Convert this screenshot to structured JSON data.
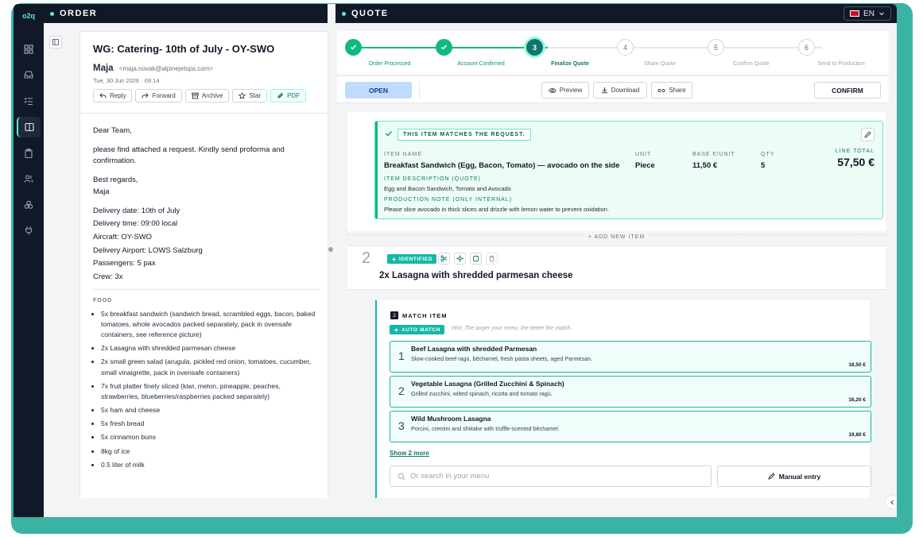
{
  "app": {
    "logo": "o2q"
  },
  "order_panel": {
    "title": "ORDER"
  },
  "quote_panel": {
    "title": "QUOTE",
    "language": "EN"
  },
  "email": {
    "subject": "WG: Catering- 10th of July - OY-SWO",
    "sender_name": "Maja",
    "sender_email": "<maja.novak@alpinejetops.com>",
    "date": "Tue, 30 Jun 2026 · 09:14",
    "actions": [
      "Reply",
      "Forward",
      "Archive",
      "Star",
      "PDF"
    ],
    "greeting": "Dear Team,",
    "intro": "please find attached a request. Kindly send proforma and confirmation.",
    "closing_1": "Best regards,",
    "closing_2": "Maja",
    "delivery": [
      "Delivery date: 10th of July",
      "Delivery time: 09:00 local",
      "Aircraft: OY-SWO",
      "Delivery Airport: LOWS Salzburg",
      "Passengers: 5 pax",
      "Crew: 3x"
    ],
    "food_label": "FOOD",
    "food": [
      "5x breakfast sandwich (sandwich bread, scrambled eggs, bacon, baked tomatoes, whole avocados packed separately, pack in ovensafe containers, see reference picture)",
      "2x Lasagna with shredded parmesan cheese",
      "2x small green salad (arugula, pickled red onion, tomatoes, cucumber, small vinaigrette, pack in ovensafe containers)",
      "7x fruit platter finely sliced (kiwi, melon, pineapple, peaches, strawberries, blueberries/raspberries packed separately)",
      "5x ham and cheese",
      "5x fresh bread",
      "5x cinnamon buns",
      "8kg of ice",
      "0.5 liter of milk"
    ]
  },
  "steps": [
    {
      "num": "✓",
      "label": "Order Processed",
      "state": "done"
    },
    {
      "num": "✓",
      "label": "Account Confirmed",
      "state": "done"
    },
    {
      "num": "3",
      "label": "Finalize Quote",
      "state": "current"
    },
    {
      "num": "4",
      "label": "Share Quote",
      "state": "todo"
    },
    {
      "num": "5",
      "label": "Confirm Quote",
      "state": "todo"
    },
    {
      "num": "6",
      "label": "Send to Production",
      "state": "todo"
    }
  ],
  "toolbar": {
    "status": "OPEN",
    "preview": "Preview",
    "download": "Download",
    "share": "Share",
    "confirm": "CONFIRM"
  },
  "item1": {
    "match_badge": "THIS ITEM MATCHES THE REQUEST.",
    "name_label": "ITEM NAME",
    "name": "Breakfast Sandwich (Egg, Bacon, Tomato) — avocado on the side",
    "unit_label": "UNIT",
    "unit": "Piece",
    "base_label": "BASE €/UNIT",
    "base": "11,50 €",
    "qty_label": "QTY",
    "qty": "5",
    "total_label": "LINE TOTAL",
    "total": "57,50 €",
    "desc_label": "ITEM DESCRIPTION (QUOTE)",
    "desc": "Egg and Bacon Sandwich, Tomato and Avocado",
    "note_label": "PRODUCTION NOTE (ONLY INTERNAL)",
    "note": "Please slice avocado in thick slices and drizzle with lemon water to prevent oxidation."
  },
  "add_new_item": "+ ADD NEW ITEM",
  "item2": {
    "number": "2",
    "status": "IDENTIFIED",
    "title": "2x Lasagna with shredded parmesan cheese",
    "match_num": "2",
    "match_title": "MATCH ITEM",
    "auto_match": "AUTO MATCH",
    "hint": "Hint: The larger your menu, the better the match.",
    "candidates": [
      {
        "num": "1",
        "name": "Beef Lasagna with shredded Parmesan",
        "desc": "Slow-cooked beef ragù, béchamel, fresh pasta sheets, aged Parmesan.",
        "price": "18,50 €"
      },
      {
        "num": "2",
        "name": "Vegetable Lasagna (Grilled Zucchini & Spinach)",
        "desc": "Grilled zucchini, wilted spinach, ricotta and tomato ragù.",
        "price": "16,20 €"
      },
      {
        "num": "3",
        "name": "Wild Mushroom Lasagna",
        "desc": "Porcini, cremini and shiitake with truffle-scented béchamel.",
        "price": "19,80 €"
      }
    ],
    "show_more": "Show 2 more",
    "search_placeholder": "Or search in your menu",
    "manual_entry": "Manual entry"
  },
  "colors": {
    "accent": "#14b8a6",
    "frame": "#3bb3a3",
    "dark": "#111827",
    "success": "#10b981"
  }
}
